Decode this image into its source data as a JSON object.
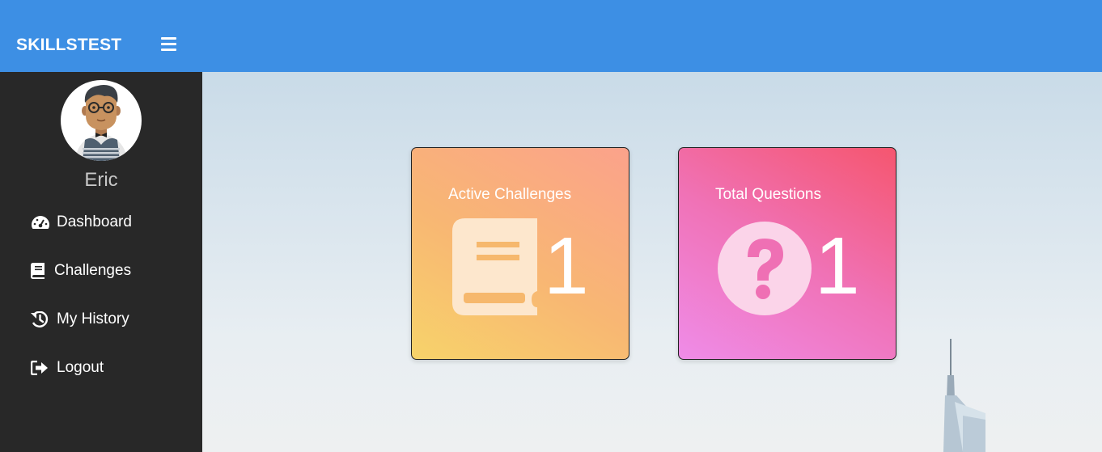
{
  "header": {
    "brand": "SKILLSTEST",
    "menu_icon": "hamburger-icon",
    "color": "#3d8fe4"
  },
  "sidebar": {
    "username": "Eric",
    "avatar_icon": "user-avatar",
    "items": [
      {
        "label": "Dashboard",
        "icon": "tachometer-icon"
      },
      {
        "label": "Challenges",
        "icon": "book-icon"
      },
      {
        "label": "My History",
        "icon": "history-icon"
      },
      {
        "label": "Logout",
        "icon": "sign-out-icon"
      }
    ]
  },
  "cards": [
    {
      "label": "Active Challenges",
      "value": "1",
      "icon": "book-icon"
    },
    {
      "label": "Total Questions",
      "value": "1",
      "icon": "question-circle-icon"
    }
  ]
}
